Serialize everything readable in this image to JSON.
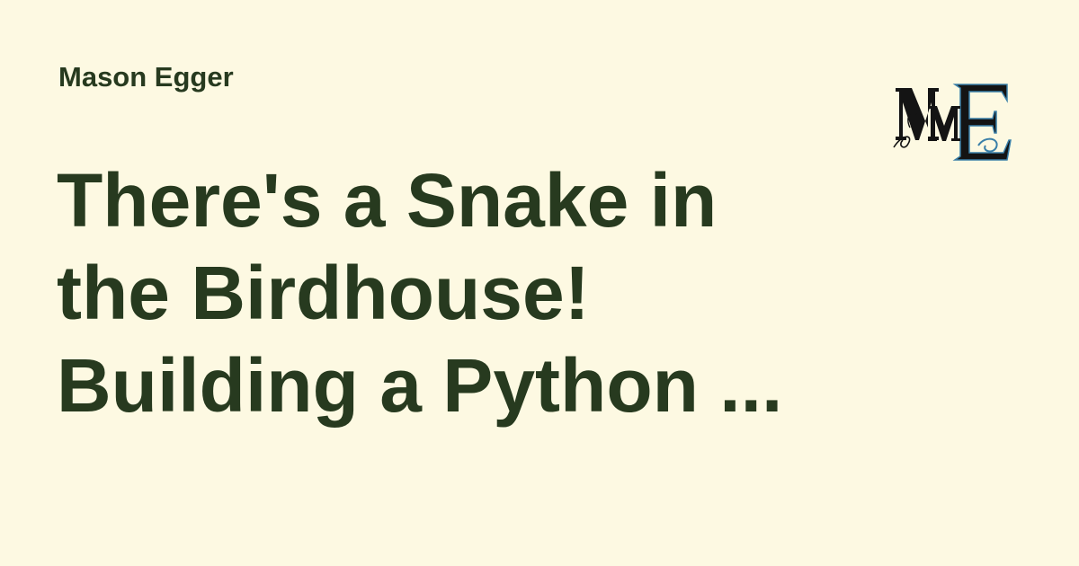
{
  "author": "Mason Egger",
  "title_lines": [
    "There's a Snake in",
    "the Birdhouse!",
    "Building a Python ..."
  ],
  "logo": {
    "icon": "monogram-logo-icon",
    "text": "MME"
  },
  "colors": {
    "background": "#fdf9e2",
    "text": "#273a1f",
    "logo_ink": "#141414",
    "logo_accent": "#3a7fa8"
  }
}
